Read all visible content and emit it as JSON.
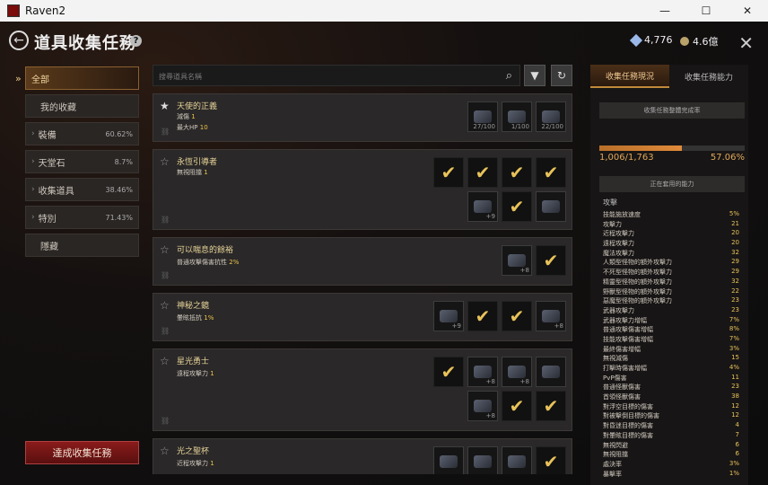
{
  "window": {
    "title": "Raven2"
  },
  "header": {
    "title": "道具收集任務",
    "currency1": "4,776",
    "currency2": "4.6億"
  },
  "sidebar": {
    "items": [
      {
        "label": "全部",
        "pct": ""
      },
      {
        "label": "我的收藏",
        "pct": ""
      },
      {
        "label": "裝備",
        "pct": "60.62%"
      },
      {
        "label": "天堂石",
        "pct": "8.7%"
      },
      {
        "label": "收集道具",
        "pct": "38.46%"
      },
      {
        "label": "特別",
        "pct": "71.43%"
      },
      {
        "label": "隱藏",
        "pct": ""
      }
    ],
    "cta": "達成收集任務"
  },
  "search": {
    "placeholder": "搜尋道具名稱"
  },
  "cards": [
    {
      "name": "天使的正義",
      "attr1": "減傷",
      "attr1v": "1",
      "attr2": "最大HP",
      "attr2v": "10",
      "counts": [
        "27/100",
        "1/100",
        "22/100"
      ]
    },
    {
      "name": "永恆引導者",
      "attr1": "無視阻擋",
      "attr1v": "1",
      "attr2": "",
      "attr2v": "",
      "counts": [
        "+9"
      ]
    },
    {
      "name": "可以喘息的餘裕",
      "attr1": "普通攻擊傷害抗性",
      "attr1v": "2%",
      "attr2": "",
      "attr2v": "",
      "counts": [
        "+8"
      ]
    },
    {
      "name": "神秘之鏡",
      "attr1": "暈眩抵抗",
      "attr1v": "1%",
      "attr2": "",
      "attr2v": "",
      "counts": [
        "+9",
        "+8"
      ]
    },
    {
      "name": "星光勇士",
      "attr1": "遠程攻擊力",
      "attr1v": "1",
      "attr2": "",
      "attr2v": "",
      "counts": [
        "+8",
        "+8",
        "+8"
      ]
    },
    {
      "name": "光之聖杯",
      "attr1": "近程攻擊力",
      "attr1v": "1",
      "attr2": "",
      "attr2v": "",
      "counts": []
    }
  ],
  "right": {
    "tab1": "收集任務現況",
    "tab2": "收集任務能力",
    "progress_title": "收集任務整體完成率",
    "progress_left": "1,006/1,763",
    "progress_right": "57.06%",
    "progress_fraction": 0.5706,
    "ability_title": "正在套用的能力",
    "stat_head": "攻擊",
    "stats": [
      [
        "技能施放速度",
        "5%"
      ],
      [
        "攻擊力",
        "21"
      ],
      [
        "近程攻擊力",
        "20"
      ],
      [
        "遠程攻擊力",
        "20"
      ],
      [
        "魔法攻擊力",
        "32"
      ],
      [
        "人類型怪物的額外攻擊力",
        "29"
      ],
      [
        "不死型怪物的額外攻擊力",
        "29"
      ],
      [
        "精靈型怪物的額外攻擊力",
        "32"
      ],
      [
        "野獸型怪物的額外攻擊力",
        "22"
      ],
      [
        "惡魔型怪物的額外攻擊力",
        "23"
      ],
      [
        "武器攻擊力",
        "23"
      ],
      [
        "武器攻擊力增幅",
        "7%"
      ],
      [
        "普通攻擊傷害增幅",
        "8%"
      ],
      [
        "技能攻擊傷害增幅",
        "7%"
      ],
      [
        "最終傷害增幅",
        "3%"
      ],
      [
        "無視減傷",
        "15"
      ],
      [
        "打擊時傷害增幅",
        "4%"
      ],
      [
        "PvP傷害",
        "11"
      ],
      [
        "普通怪獸傷害",
        "23"
      ],
      [
        "首領怪獸傷害",
        "38"
      ],
      [
        "對浮空目標的傷害",
        "12"
      ],
      [
        "對被擊倒目標的傷害",
        "12"
      ],
      [
        "對昏迷目標的傷害",
        "4"
      ],
      [
        "對暈眩目標的傷害",
        "7"
      ],
      [
        "無視閃避",
        "6"
      ],
      [
        "無視阻擋",
        "6"
      ],
      [
        "處決率",
        "3%"
      ],
      [
        "暴擊率",
        "1%"
      ]
    ]
  }
}
